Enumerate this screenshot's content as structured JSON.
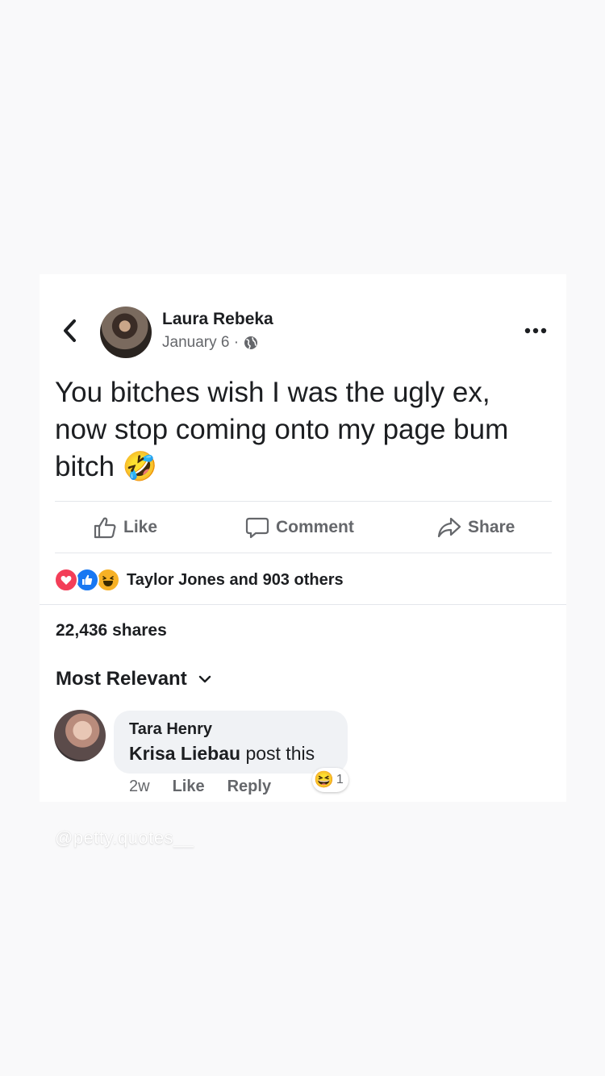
{
  "post": {
    "author": "Laura Rebeka",
    "date": "January 6 ·",
    "text": "You bitches wish I was the ugly ex, now stop coming onto my page bum bitch",
    "text_emoji": "🤣"
  },
  "actions": {
    "like": "Like",
    "comment": "Comment",
    "share": "Share"
  },
  "reactions": {
    "summary": "Taylor Jones and 903 others",
    "types": [
      "love",
      "like",
      "haha"
    ]
  },
  "shares": "22,436 shares",
  "comments_sort": "Most Relevant",
  "comment": {
    "author": "Tara Henry",
    "mention": "Krisa Liebau",
    "text": "post this",
    "time": "2w",
    "like": "Like",
    "reply": "Reply",
    "reaction_count": "1",
    "reaction_emoji": "😆"
  },
  "watermark": "@petty.quotes__",
  "colors": {
    "meta_gray": "#65676b",
    "love_red": "#f33e58",
    "like_blue": "#1877f2",
    "haha_yellow": "#f7b125"
  }
}
